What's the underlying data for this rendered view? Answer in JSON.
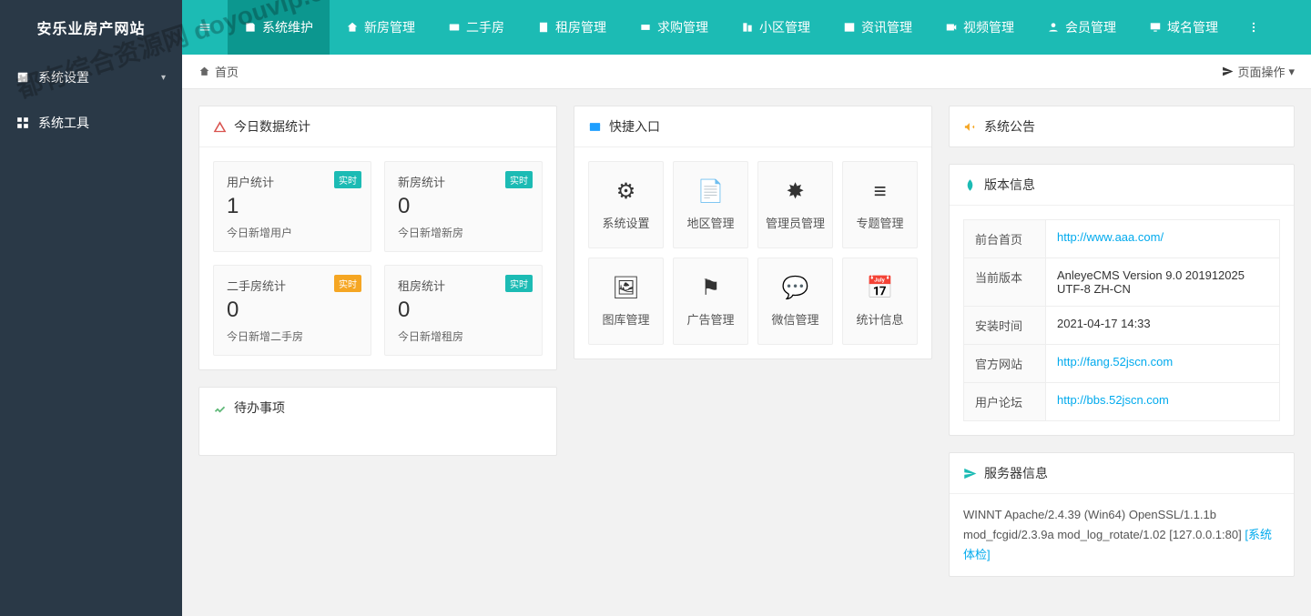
{
  "site": {
    "logo": "安乐业房产网站"
  },
  "sidebar": {
    "items": [
      {
        "label": "系统设置"
      },
      {
        "label": "系统工具"
      }
    ]
  },
  "topnav": {
    "items": [
      {
        "label": "系统维护",
        "active": true
      },
      {
        "label": "新房管理"
      },
      {
        "label": "二手房"
      },
      {
        "label": "租房管理"
      },
      {
        "label": "求购管理"
      },
      {
        "label": "小区管理"
      },
      {
        "label": "资讯管理"
      },
      {
        "label": "视频管理"
      },
      {
        "label": "会员管理"
      },
      {
        "label": "域名管理"
      }
    ]
  },
  "breadcrumb": {
    "home": "首页",
    "pageop": "页面操作"
  },
  "stats": {
    "title": "今日数据统计",
    "badge": "实时",
    "boxes": [
      {
        "title": "用户统计",
        "value": "1",
        "sub": "今日新增用户",
        "badgeColor": "green"
      },
      {
        "title": "新房统计",
        "value": "0",
        "sub": "今日新增新房",
        "badgeColor": "green"
      },
      {
        "title": "二手房统计",
        "value": "0",
        "sub": "今日新增二手房",
        "badgeColor": "orange"
      },
      {
        "title": "租房统计",
        "value": "0",
        "sub": "今日新增租房",
        "badgeColor": "green"
      }
    ]
  },
  "quick": {
    "title": "快捷入口",
    "items": [
      {
        "label": "系统设置",
        "icon": "⚙"
      },
      {
        "label": "地区管理",
        "icon": "📄"
      },
      {
        "label": "管理员管理",
        "icon": "✸"
      },
      {
        "label": "专题管理",
        "icon": "≡"
      },
      {
        "label": "图库管理",
        "icon": "🖼"
      },
      {
        "label": "广告管理",
        "icon": "⚑"
      },
      {
        "label": "微信管理",
        "icon": "💬"
      },
      {
        "label": "统计信息",
        "icon": "📅"
      }
    ]
  },
  "todo": {
    "title": "待办事项"
  },
  "notice": {
    "title": "系统公告"
  },
  "version": {
    "title": "版本信息",
    "rows": {
      "front_k": "前台首页",
      "front_v": "http://www.aaa.com/",
      "ver_k": "当前版本",
      "ver_v": "AnleyeCMS Version 9.0 201912025 UTF-8 ZH-CN",
      "install_k": "安装时间",
      "install_v": "2021-04-17 14:33",
      "site_k": "官方网站",
      "site_v": "http://fang.52jscn.com",
      "bbs_k": "用户论坛",
      "bbs_v": "http://bbs.52jscn.com"
    }
  },
  "server": {
    "title": "服务器信息",
    "text": "WINNT Apache/2.4.39 (Win64) OpenSSL/1.1.1b mod_fcgid/2.3.9a mod_log_rotate/1.02 [127.0.0.1:80] ",
    "link": "[系统体检]"
  },
  "watermark": "都有综合资源网\ndoyouvip.com"
}
